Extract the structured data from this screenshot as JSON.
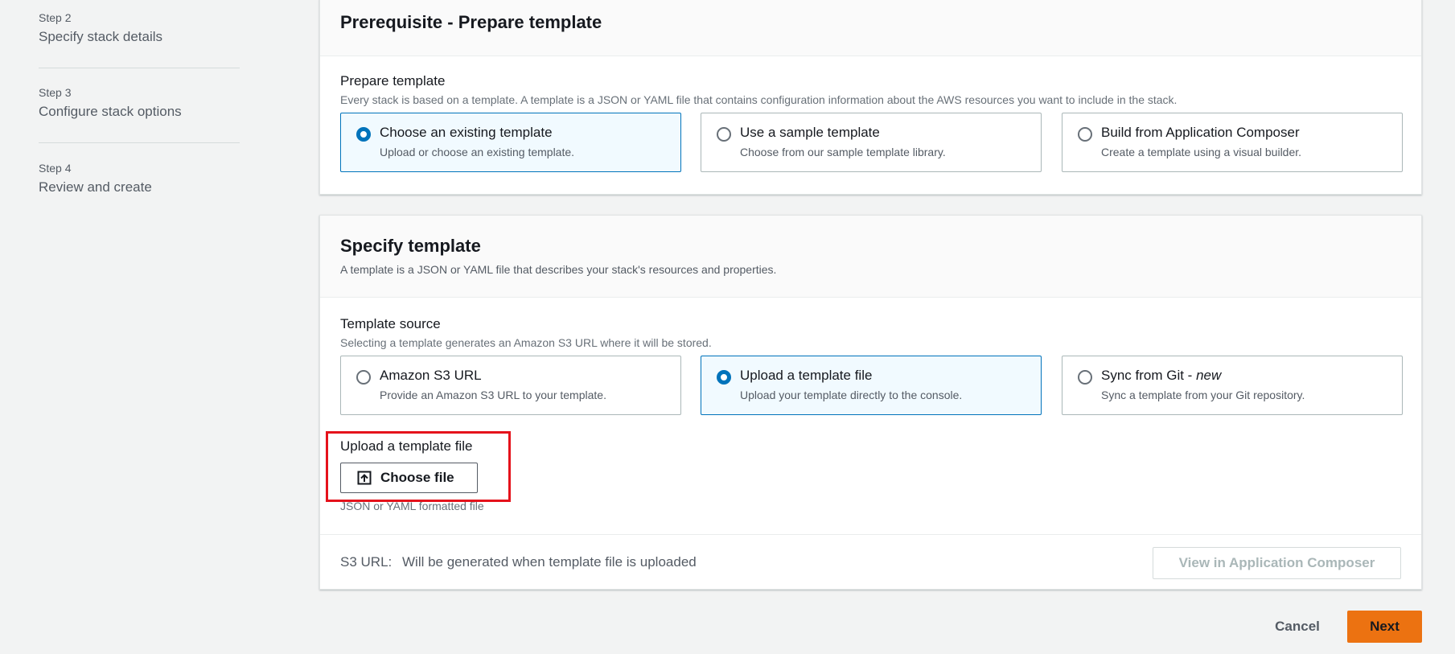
{
  "sidebar": {
    "steps": [
      {
        "number": "Step 2",
        "title": "Specify stack details"
      },
      {
        "number": "Step 3",
        "title": "Configure stack options"
      },
      {
        "number": "Step 4",
        "title": "Review and create"
      }
    ]
  },
  "prerequisite": {
    "title": "Prerequisite - Prepare template",
    "field_label": "Prepare template",
    "field_description": "Every stack is based on a template. A template is a JSON or YAML file that contains configuration information about the AWS resources you want to include in the stack.",
    "options": [
      {
        "title": "Choose an existing template",
        "description": "Upload or choose an existing template.",
        "selected": true
      },
      {
        "title": "Use a sample template",
        "description": "Choose from our sample template library.",
        "selected": false
      },
      {
        "title": "Build from Application Composer",
        "description": "Create a template using a visual builder.",
        "selected": false
      }
    ]
  },
  "specify": {
    "title": "Specify template",
    "description": "A template is a JSON or YAML file that describes your stack's resources and properties.",
    "source_label": "Template source",
    "source_description": "Selecting a template generates an Amazon S3 URL where it will be stored.",
    "options": [
      {
        "title": "Amazon S3 URL",
        "title_suffix": "",
        "description": "Provide an Amazon S3 URL to your template.",
        "selected": false
      },
      {
        "title": "Upload a template file",
        "title_suffix": "",
        "description": "Upload your template directly to the console.",
        "selected": true
      },
      {
        "title": "Sync from Git - ",
        "title_suffix": "new",
        "description": "Sync a template from your Git repository.",
        "selected": false
      }
    ],
    "upload_label": "Upload a template file",
    "choose_file_label": "Choose file",
    "file_hint": "JSON or YAML formatted file",
    "s3_url_label": "S3 URL:",
    "s3_url_value": "Will be generated when template file is uploaded",
    "composer_button": "View in Application Composer"
  },
  "footer": {
    "cancel_label": "Cancel",
    "next_label": "Next"
  },
  "colors": {
    "accent": "#0073bb",
    "primary_button": "#ec7211",
    "highlight": "#e5121b"
  }
}
